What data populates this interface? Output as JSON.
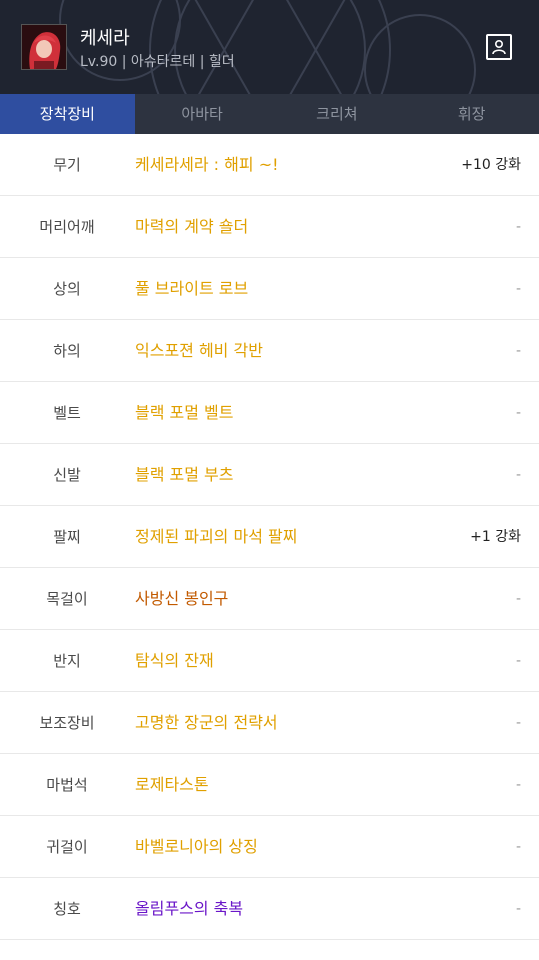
{
  "header": {
    "name": "케세라",
    "info": "Lv.90 | 아슈타르테 | 힐더"
  },
  "tabs": [
    {
      "label": "장착장비",
      "active": true
    },
    {
      "label": "아바타",
      "active": false
    },
    {
      "label": "크리쳐",
      "active": false
    },
    {
      "label": "휘장",
      "active": false
    }
  ],
  "equipment": [
    {
      "slot": "무기",
      "item": "케세라세라 : 해피 ~!",
      "enhance": "+10 강화",
      "color": "#e0a000"
    },
    {
      "slot": "머리어깨",
      "item": "마력의 계약 숄더",
      "enhance": "-",
      "color": "#e0a000"
    },
    {
      "slot": "상의",
      "item": "풀 브라이트 로브",
      "enhance": "-",
      "color": "#e0a000"
    },
    {
      "slot": "하의",
      "item": "익스포젼 헤비 각반",
      "enhance": "-",
      "color": "#e0a000"
    },
    {
      "slot": "벨트",
      "item": "블랙 포멀 벨트",
      "enhance": "-",
      "color": "#e0a000"
    },
    {
      "slot": "신발",
      "item": "블랙 포멀 부츠",
      "enhance": "-",
      "color": "#e0a000"
    },
    {
      "slot": "팔찌",
      "item": "정제된 파괴의 마석 팔찌",
      "enhance": "+1 강화",
      "color": "#e0a000"
    },
    {
      "slot": "목걸이",
      "item": "사방신 봉인구",
      "enhance": "-",
      "color": "#c25a00"
    },
    {
      "slot": "반지",
      "item": "탐식의 잔재",
      "enhance": "-",
      "color": "#e0a000"
    },
    {
      "slot": "보조장비",
      "item": "고명한 장군의 전략서",
      "enhance": "-",
      "color": "#e0a000"
    },
    {
      "slot": "마법석",
      "item": "로제타스톤",
      "enhance": "-",
      "color": "#e0a000"
    },
    {
      "slot": "귀걸이",
      "item": "바벨로니아의 상징",
      "enhance": "-",
      "color": "#e0a000"
    },
    {
      "slot": "칭호",
      "item": "올림푸스의 축복",
      "enhance": "-",
      "color": "#6a16c8"
    }
  ]
}
